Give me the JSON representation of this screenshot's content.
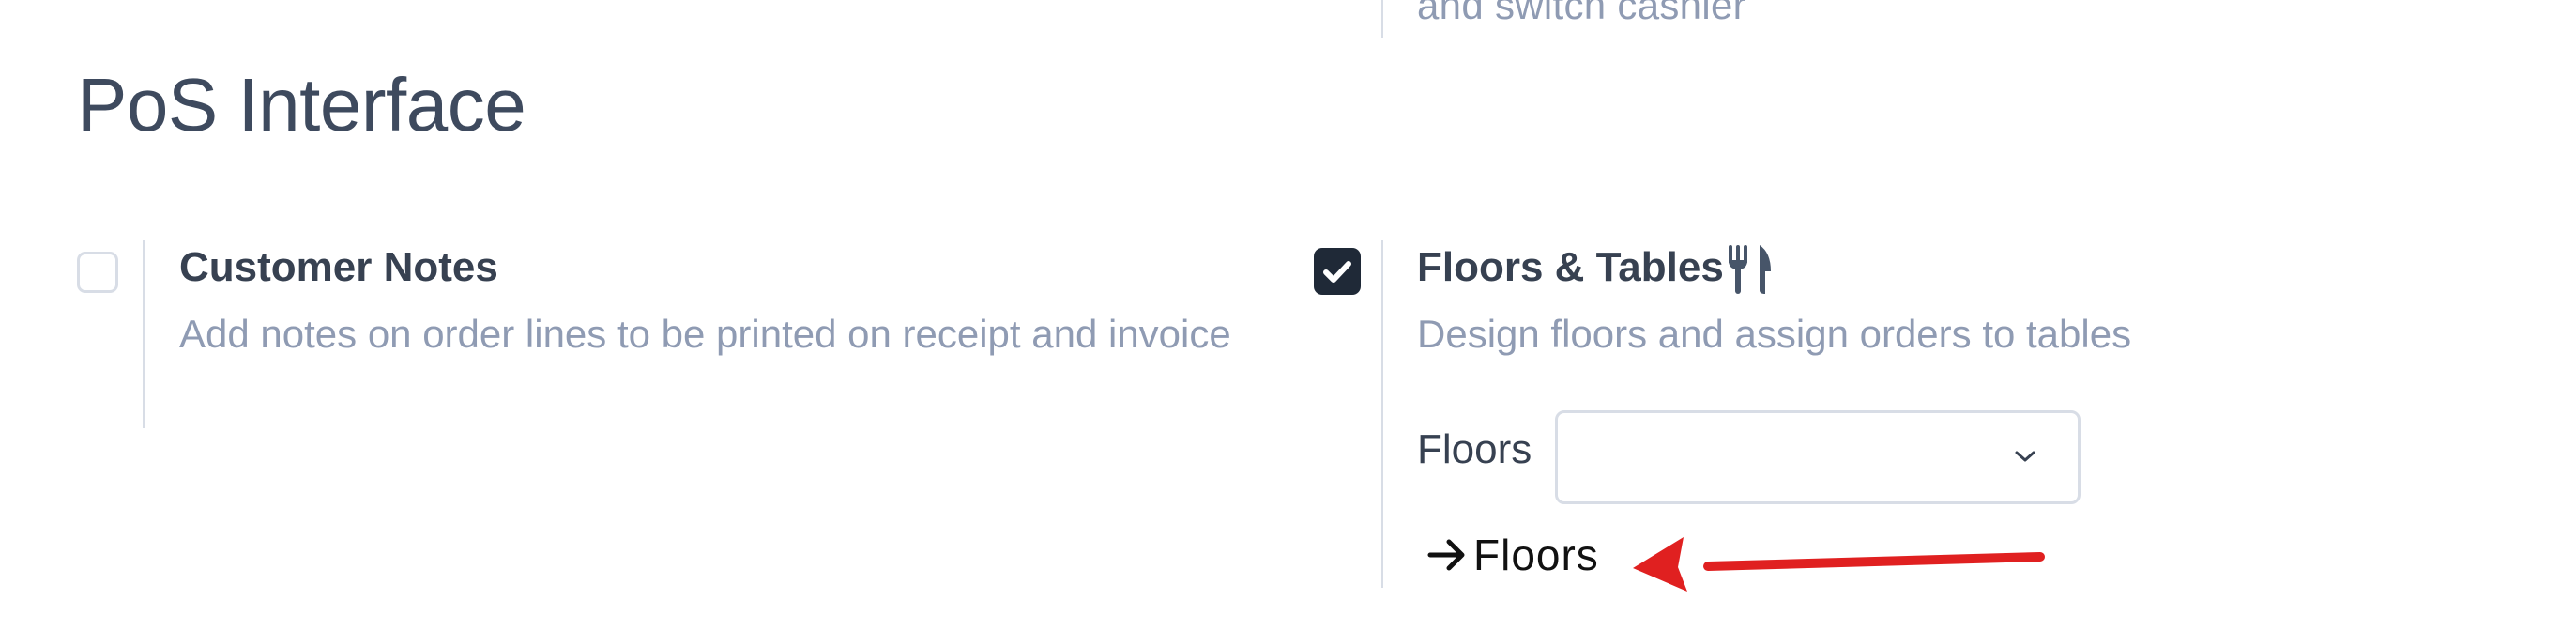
{
  "top_partial": {
    "text": "and switch cashier"
  },
  "section": {
    "title": "PoS Interface"
  },
  "customer_notes": {
    "title": "Customer Notes",
    "description": "Add notes on order lines to be printed on receipt and invoice",
    "checked": false
  },
  "floors_tables": {
    "title": "Floors & Tables",
    "title_icon": "utensils-icon",
    "description": "Design floors and assign orders to tables",
    "checked": true,
    "floors_field": {
      "label": "Floors",
      "value": ""
    },
    "floors_link": {
      "label": "Floors",
      "icon": "arrow-right-icon"
    }
  },
  "annotation": {
    "color": "#e02020",
    "icon": "red-arrow-icon"
  },
  "colors": {
    "checkbox_checked": "#1f2937",
    "muted_text": "#8f9bb3",
    "divider": "#d8dde6"
  }
}
